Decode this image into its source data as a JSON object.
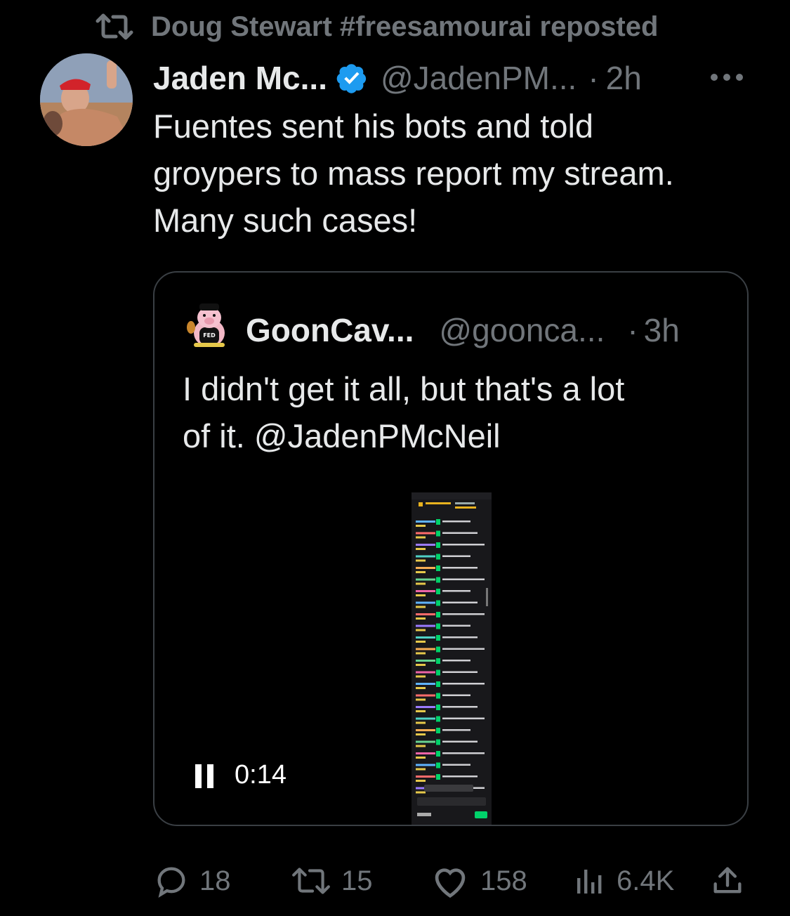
{
  "repost": {
    "text": "Doug Stewart #freesamourai reposted",
    "icon": "repost-icon"
  },
  "tweet": {
    "author_name": "Jaden Mc...",
    "author_handle": "@JadenPM...",
    "dot": "·",
    "time": "2h",
    "verified": true,
    "text_lines": [
      "Fuentes sent his bots and told",
      "groypers to mass report my stream.",
      "Many such cases!"
    ]
  },
  "quote": {
    "author_name": "GoonCav...",
    "author_handle": "@goonca...",
    "dot": "·",
    "time": "3h",
    "text_lines": [
      "I didn't get it all, but that's a lot",
      "of it. @JadenPMcNeil"
    ],
    "video": {
      "time": "0:14",
      "state": "playing"
    }
  },
  "actions": {
    "replies": "18",
    "reposts": "15",
    "likes": "158",
    "views": "6.4K"
  },
  "colors": {
    "background": "#000000",
    "text": "#e7e9ea",
    "muted": "#71767b",
    "verified": "#1d9bf0",
    "chat_green": "#00d26a"
  }
}
